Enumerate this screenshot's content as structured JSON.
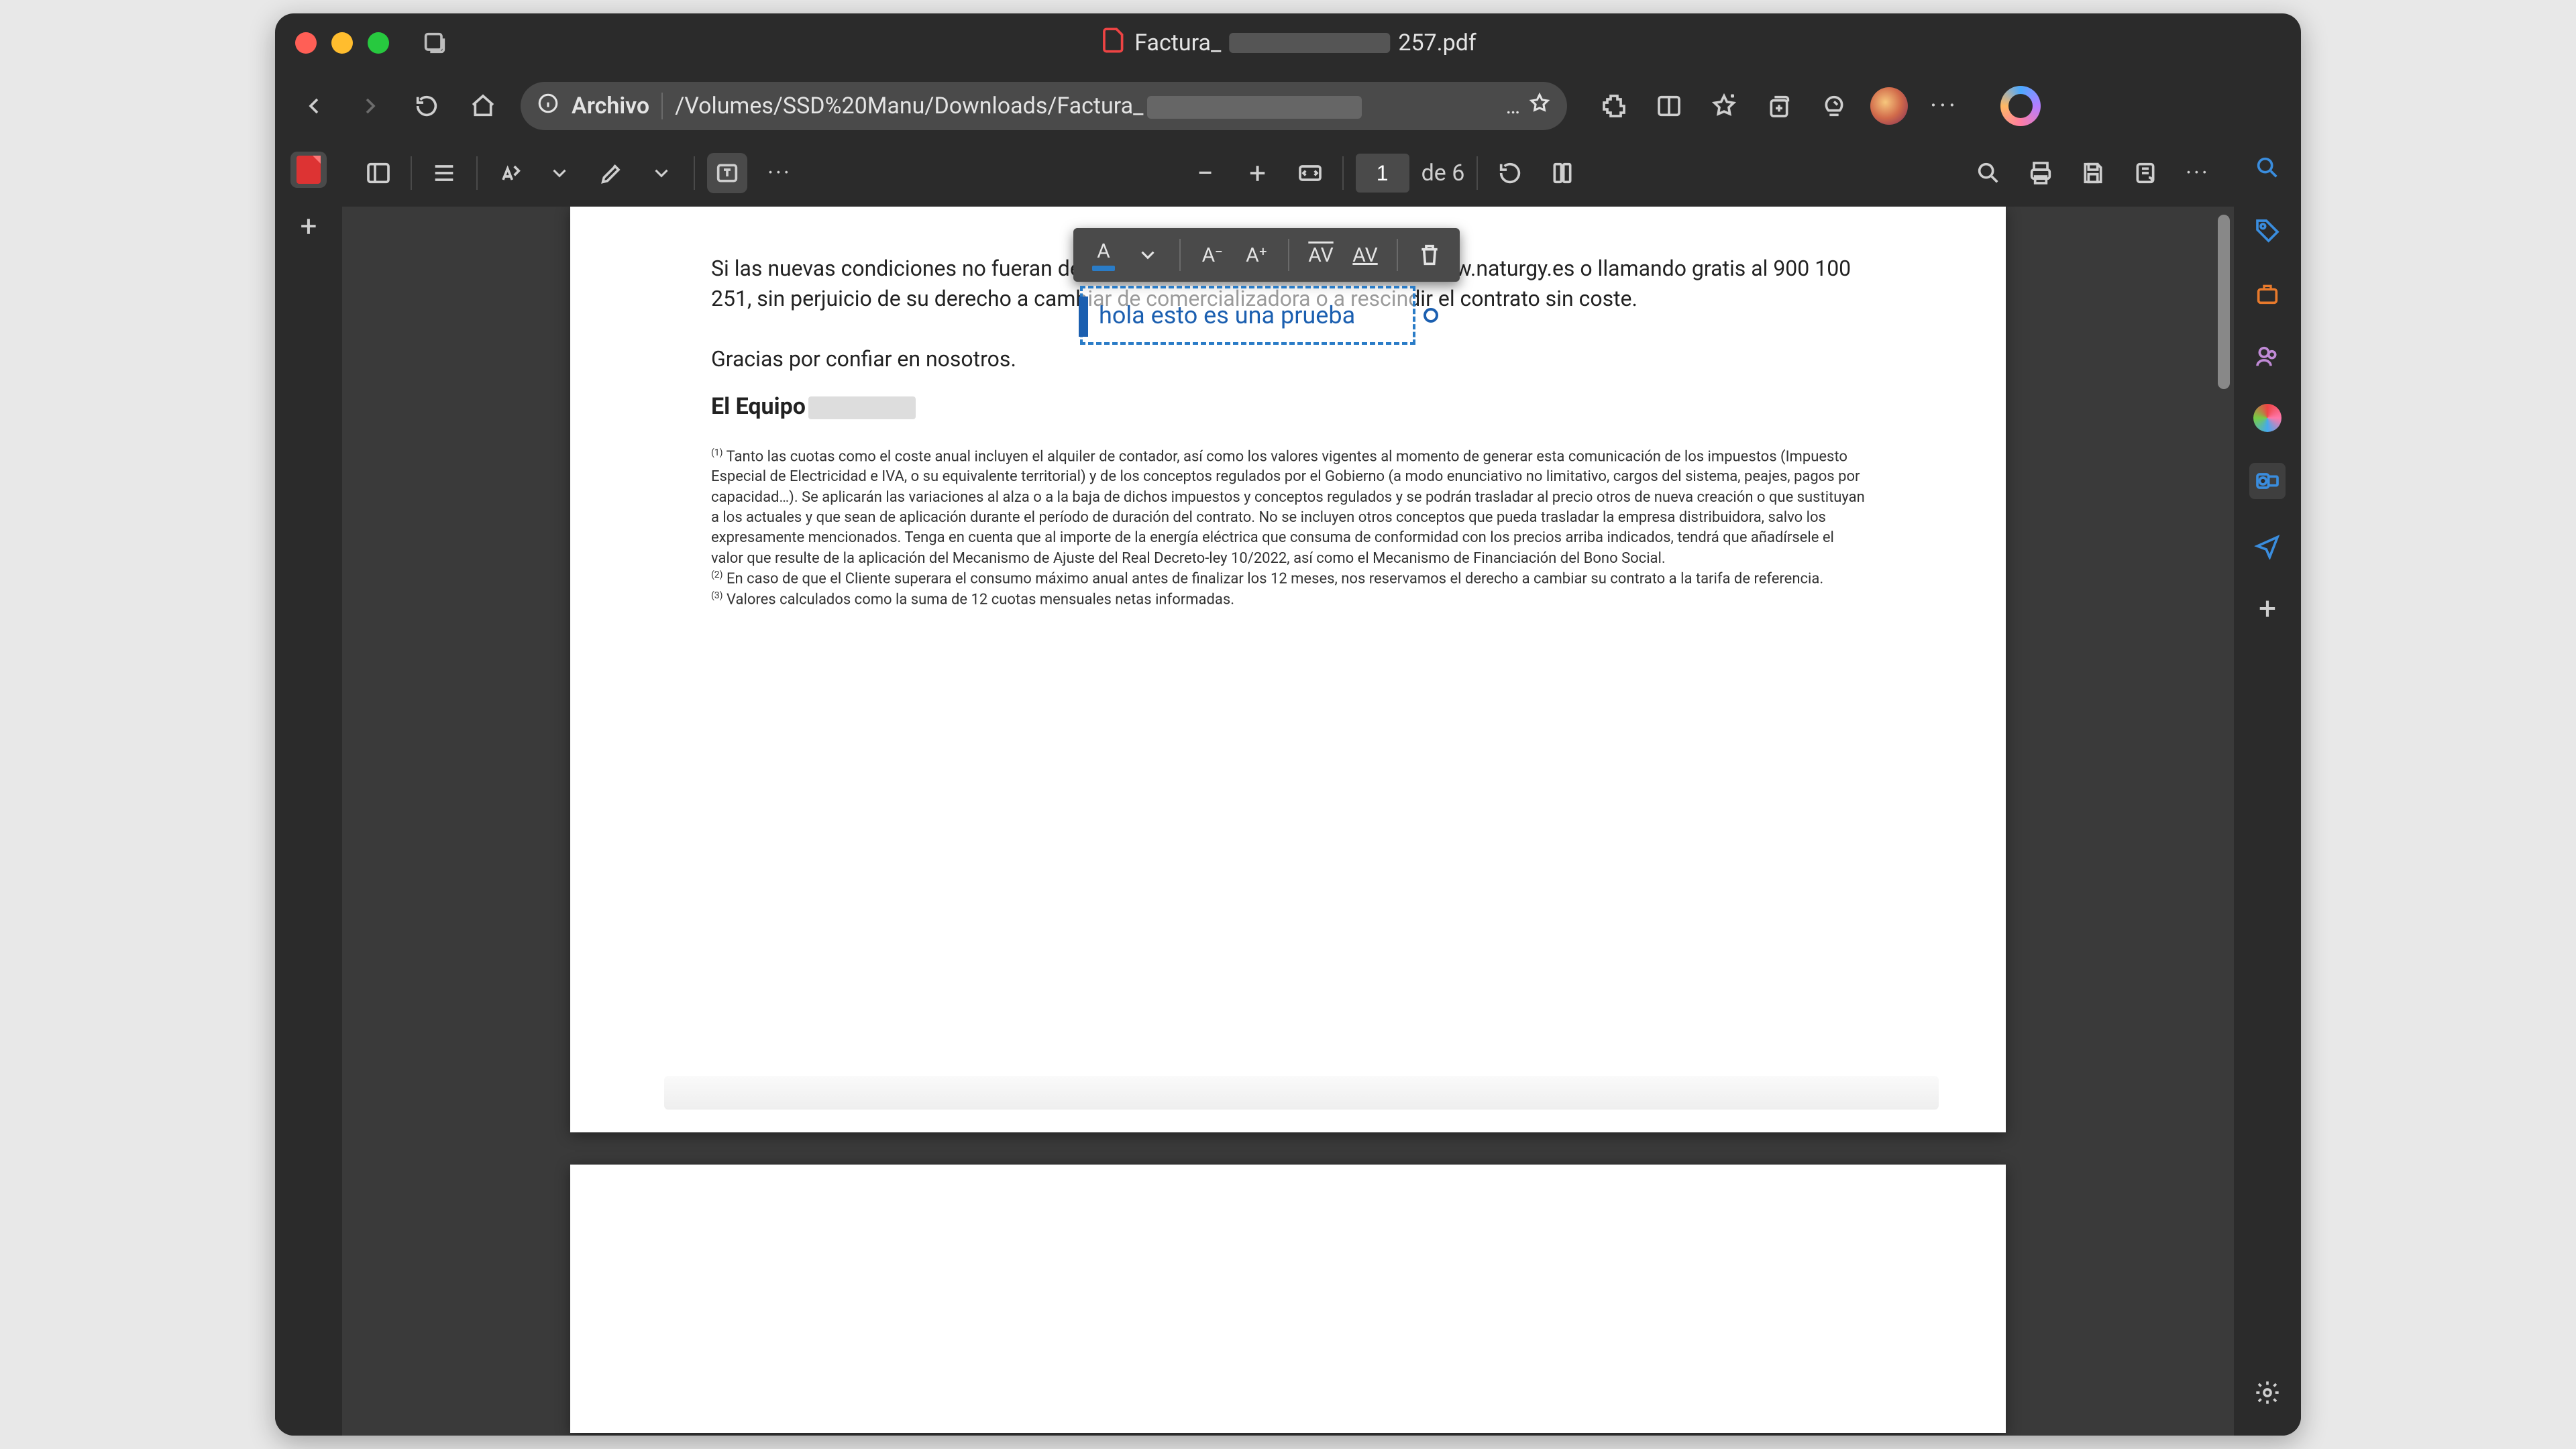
{
  "titlebar": {
    "filename_prefix": "Factura_",
    "filename_suffix": "257.pdf"
  },
  "address": {
    "protocol_label": "Archivo",
    "path_prefix": "/Volumes/SSD%20Manu/Downloads/Factura_"
  },
  "pdfToolbar": {
    "page_current": "1",
    "page_total_label": "de 6"
  },
  "annotation": {
    "text": "hola esto es una prueba"
  },
  "document": {
    "paragraph": "Si las nuevas condiciones no fueran de su interés…                                                                                              as actuales a través de www.naturgy.es o llamando gratis al 900 100 251, sin perjuicio de su derecho a cambiar de comercializadora o a rescindir el contrato sin coste.",
    "thanks": "Gracias por confiar en nosotros.",
    "team": "El Equipo",
    "foot1": "Tanto las cuotas como el coste anual incluyen el alquiler de contador, así como los valores vigentes al momento de generar esta comunicación de los impuestos (Impuesto Especial de Electricidad e IVA, o su equivalente territorial) y de los conceptos regulados por el Gobierno (a modo enunciativo no limitativo, cargos del sistema, peajes, pagos por capacidad…). Se aplicarán las variaciones al alza o a la baja de dichos impuestos y conceptos regulados y se podrán trasladar al precio otros de nueva creación o que sustituyan a los actuales y que sean de aplicación durante el período de duración del contrato. No se incluyen otros conceptos que pueda trasladar la empresa distribuidora, salvo los expresamente mencionados. Tenga en cuenta que al importe de la energía eléctrica que consuma de conformidad con los precios arriba indicados, tendrá que añadírsele el valor que resulte de la aplicación del Mecanismo de Ajuste del Real Decreto-ley 10/2022, así como el Mecanismo de Financiación del Bono Social.",
    "foot2": "En caso de que el Cliente superara el consumo máximo anual antes de finalizar los 12 meses, nos reservamos el derecho a cambiar su contrato a la tarifa de referencia.",
    "foot3": "Valores calculados como la suma de 12 cuotas mensuales netas informadas."
  },
  "annotToolbar": {
    "decrease": "A⁻",
    "increase": "A⁺",
    "spacing_dec": "AV",
    "spacing_inc": "AV"
  }
}
